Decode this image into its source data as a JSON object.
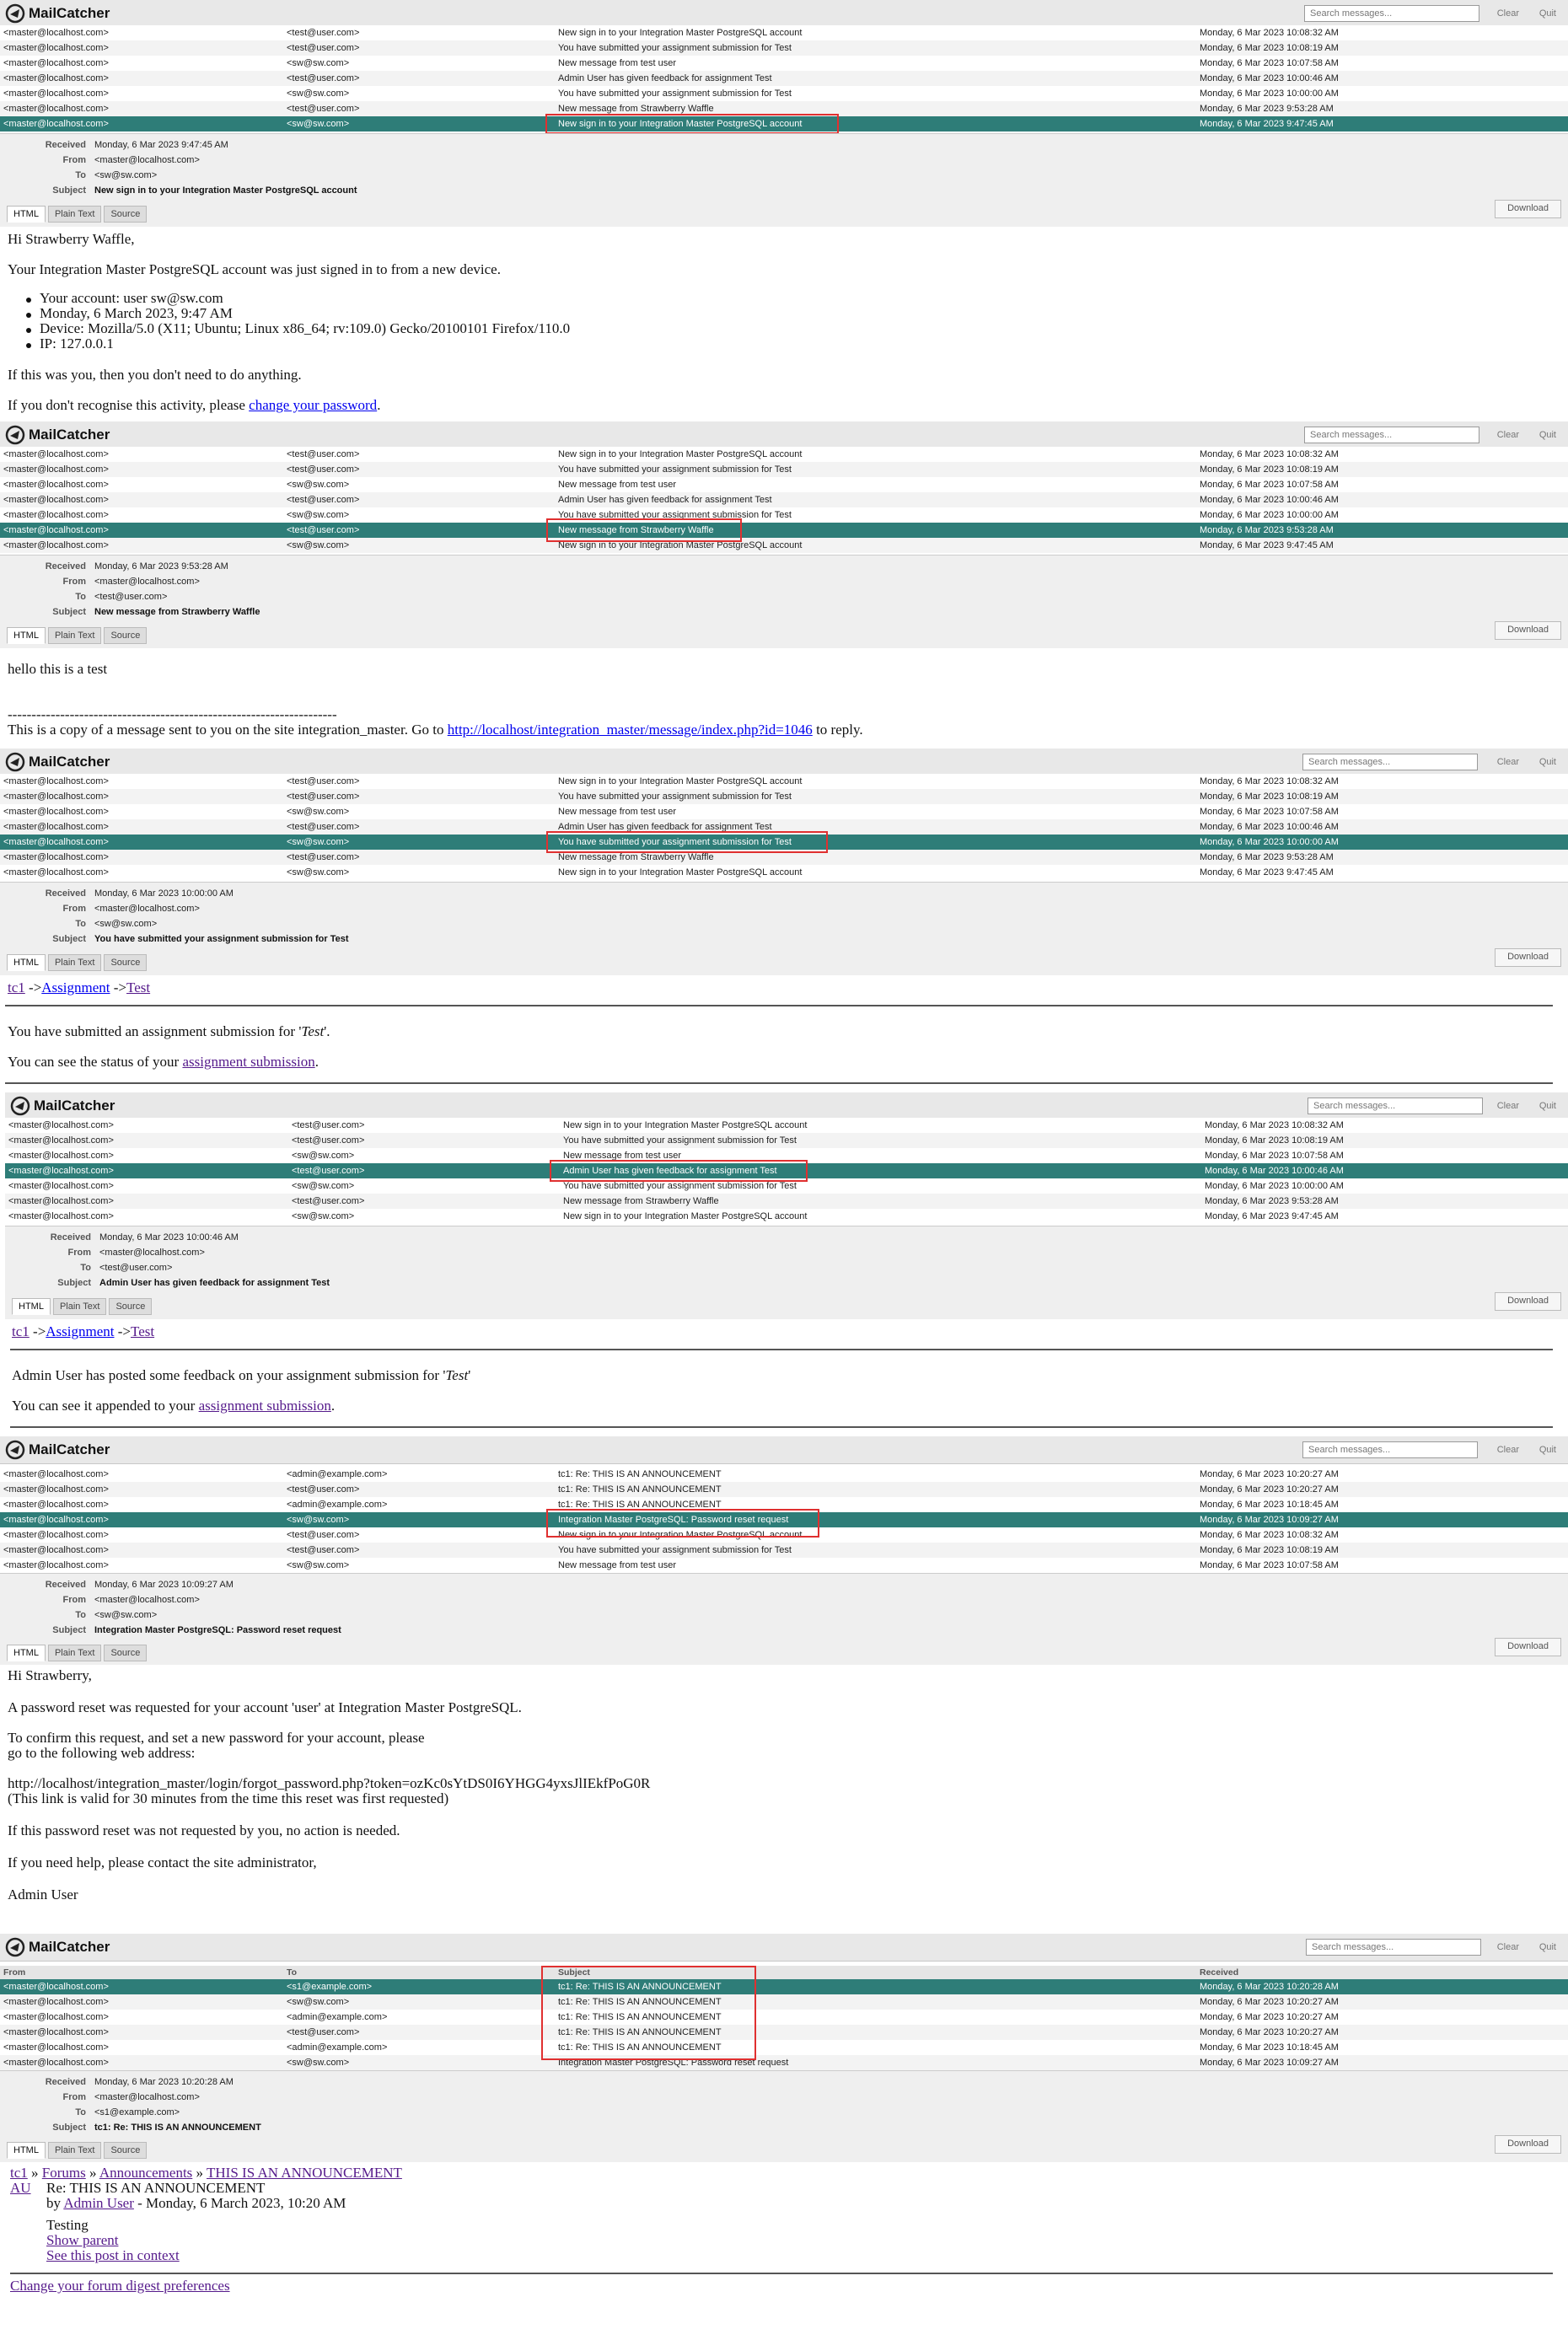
{
  "app": {
    "name": "MailCatcher",
    "search_placeholder": "Search messages...",
    "clear_label": "Clear",
    "quit_label": "Quit",
    "download_label": "Download"
  },
  "tabs": {
    "html": "HTML",
    "plain": "Plain Text",
    "source": "Source"
  },
  "meta_labels": {
    "received": "Received",
    "from": "From",
    "to": "To",
    "subject": "Subject"
  },
  "columns": {
    "from": "From",
    "to": "To",
    "subject": "Subject",
    "received": "Received"
  },
  "p1": {
    "rows": [
      {
        "from": "<master@localhost.com>",
        "to": "<test@user.com>",
        "subject": "New sign in to your Integration Master PostgreSQL account",
        "received": "Monday, 6 Mar 2023 10:08:32 AM"
      },
      {
        "from": "<master@localhost.com>",
        "to": "<test@user.com>",
        "subject": "You have submitted your assignment submission for Test",
        "received": "Monday, 6 Mar 2023 10:08:19 AM"
      },
      {
        "from": "<master@localhost.com>",
        "to": "<sw@sw.com>",
        "subject": "New message from test user",
        "received": "Monday, 6 Mar 2023 10:07:58 AM"
      },
      {
        "from": "<master@localhost.com>",
        "to": "<test@user.com>",
        "subject": "Admin User has given feedback for assignment Test",
        "received": "Monday, 6 Mar 2023 10:00:46 AM"
      },
      {
        "from": "<master@localhost.com>",
        "to": "<sw@sw.com>",
        "subject": "You have submitted your assignment submission for Test",
        "received": "Monday, 6 Mar 2023 10:00:00 AM"
      },
      {
        "from": "<master@localhost.com>",
        "to": "<test@user.com>",
        "subject": "New message from Strawberry Waffle",
        "received": "Monday, 6 Mar 2023 9:53:28 AM"
      },
      {
        "from": "<master@localhost.com>",
        "to": "<sw@sw.com>",
        "subject": "New sign in to your Integration Master PostgreSQL account",
        "received": "Monday, 6 Mar 2023 9:47:45 AM"
      }
    ],
    "meta": {
      "received": "Monday, 6 Mar 2023 9:47:45 AM",
      "from": "<master@localhost.com>",
      "to": "<sw@sw.com>",
      "subject": "New sign in to your Integration Master PostgreSQL account"
    },
    "greeting": "Hi Strawberry Waffle,",
    "intro": "Your Integration Master PostgreSQL account was just signed in to from a new device.",
    "bullets": [
      "Your account: user sw@sw.com",
      "Monday, 6 March 2023, 9:47 AM",
      "Device: Mozilla/5.0 (X11; Ubuntu; Linux x86_64; rv:109.0) Gecko/20100101 Firefox/110.0",
      "IP: 127.0.0.1"
    ],
    "if_you": "If this was you, then you don't need to do anything.",
    "dont_recognise": "If you don't recognise this activity, please",
    "change_link": "change your password",
    "period": "."
  },
  "p2": {
    "rows": [
      {
        "from": "<master@localhost.com>",
        "to": "<test@user.com>",
        "subject": "New sign in to your Integration Master PostgreSQL account",
        "received": "Monday, 6 Mar 2023 10:08:32 AM"
      },
      {
        "from": "<master@localhost.com>",
        "to": "<test@user.com>",
        "subject": "You have submitted your assignment submission for Test",
        "received": "Monday, 6 Mar 2023 10:08:19 AM"
      },
      {
        "from": "<master@localhost.com>",
        "to": "<sw@sw.com>",
        "subject": "New message from test user",
        "received": "Monday, 6 Mar 2023 10:07:58 AM"
      },
      {
        "from": "<master@localhost.com>",
        "to": "<test@user.com>",
        "subject": "Admin User has given feedback for assignment Test",
        "received": "Monday, 6 Mar 2023 10:00:46 AM"
      },
      {
        "from": "<master@localhost.com>",
        "to": "<sw@sw.com>",
        "subject": "You have submitted your assignment submission for Test",
        "received": "Monday, 6 Mar 2023 10:00:00 AM"
      },
      {
        "from": "<master@localhost.com>",
        "to": "<test@user.com>",
        "subject": "New message from Strawberry Waffle",
        "received": "Monday, 6 Mar 2023 9:53:28 AM"
      },
      {
        "from": "<master@localhost.com>",
        "to": "<sw@sw.com>",
        "subject": "New sign in to your Integration Master PostgreSQL account",
        "received": "Monday, 6 Mar 2023 9:47:45 AM"
      }
    ],
    "meta": {
      "received": "Monday, 6 Mar 2023 9:53:28 AM",
      "from": "<master@localhost.com>",
      "to": "<test@user.com>",
      "subject": "New message from Strawberry Waffle"
    },
    "line1": "hello this is a test",
    "dashes": "---------------------------------------------------------------------",
    "copy_text": "This is a copy of a message sent to you on the site integration_master. Go to",
    "copy_link": "http://localhost/integration_master/message/index.php?id=1046",
    "copy_end": "to reply."
  },
  "p3": {
    "rows": [
      {
        "from": "<master@localhost.com>",
        "to": "<test@user.com>",
        "subject": "New sign in to your Integration Master PostgreSQL account",
        "received": "Monday, 6 Mar 2023 10:08:32 AM"
      },
      {
        "from": "<master@localhost.com>",
        "to": "<test@user.com>",
        "subject": "You have submitted your assignment submission for Test",
        "received": "Monday, 6 Mar 2023 10:08:19 AM"
      },
      {
        "from": "<master@localhost.com>",
        "to": "<sw@sw.com>",
        "subject": "New message from test user",
        "received": "Monday, 6 Mar 2023 10:07:58 AM"
      },
      {
        "from": "<master@localhost.com>",
        "to": "<test@user.com>",
        "subject": "Admin User has given feedback for assignment Test",
        "received": "Monday, 6 Mar 2023 10:00:46 AM"
      },
      {
        "from": "<master@localhost.com>",
        "to": "<sw@sw.com>",
        "subject": "You have submitted your assignment submission for Test",
        "received": "Monday, 6 Mar 2023 10:00:00 AM"
      },
      {
        "from": "<master@localhost.com>",
        "to": "<test@user.com>",
        "subject": "New message from Strawberry Waffle",
        "received": "Monday, 6 Mar 2023 9:53:28 AM"
      },
      {
        "from": "<master@localhost.com>",
        "to": "<sw@sw.com>",
        "subject": "New sign in to your Integration Master PostgreSQL account",
        "received": "Monday, 6 Mar 2023 9:47:45 AM"
      }
    ],
    "meta": {
      "received": "Monday, 6 Mar 2023 10:00:00 AM",
      "from": "<master@localhost.com>",
      "to": "<sw@sw.com>",
      "subject": "You have submitted your assignment submission for Test"
    },
    "crumb": [
      "tc1",
      "Assignment",
      "Test"
    ],
    "arrow": "->",
    "line1_pre": "You have submitted an assignment submission for '",
    "line1_em": "Test",
    "line1_post": "'.",
    "line2_pre": "You can see the status of your",
    "line2_link": "assignment submission",
    "line2_post": "."
  },
  "p4": {
    "rows": [
      {
        "from": "<master@localhost.com>",
        "to": "<test@user.com>",
        "subject": "New sign in to your Integration Master PostgreSQL account",
        "received": "Monday, 6 Mar 2023 10:08:32 AM"
      },
      {
        "from": "<master@localhost.com>",
        "to": "<test@user.com>",
        "subject": "You have submitted your assignment submission for Test",
        "received": "Monday, 6 Mar 2023 10:08:19 AM"
      },
      {
        "from": "<master@localhost.com>",
        "to": "<sw@sw.com>",
        "subject": "New message from test user",
        "received": "Monday, 6 Mar 2023 10:07:58 AM"
      },
      {
        "from": "<master@localhost.com>",
        "to": "<test@user.com>",
        "subject": "Admin User has given feedback for assignment Test",
        "received": "Monday, 6 Mar 2023 10:00:46 AM"
      },
      {
        "from": "<master@localhost.com>",
        "to": "<sw@sw.com>",
        "subject": "You have submitted your assignment submission for Test",
        "received": "Monday, 6 Mar 2023 10:00:00 AM"
      },
      {
        "from": "<master@localhost.com>",
        "to": "<test@user.com>",
        "subject": "New message from Strawberry Waffle",
        "received": "Monday, 6 Mar 2023 9:53:28 AM"
      },
      {
        "from": "<master@localhost.com>",
        "to": "<sw@sw.com>",
        "subject": "New sign in to your Integration Master PostgreSQL account",
        "received": "Monday, 6 Mar 2023 9:47:45 AM"
      }
    ],
    "meta": {
      "received": "Monday, 6 Mar 2023 10:00:46 AM",
      "from": "<master@localhost.com>",
      "to": "<test@user.com>",
      "subject": "Admin User has given feedback for assignment Test"
    },
    "crumb": [
      "tc1",
      "Assignment",
      "Test"
    ],
    "arrow": "->",
    "line1_pre": "Admin User has posted some feedback on your assignment submission for '",
    "line1_em": "Test",
    "line1_post": "'",
    "line2_pre": "You can see it appended to your",
    "line2_link": "assignment submission",
    "line2_post": "."
  },
  "p5": {
    "rows": [
      {
        "from": "<master@localhost.com>",
        "to": "<admin@example.com>",
        "subject": "tc1: Re: THIS IS AN ANNOUNCEMENT",
        "received": "Monday, 6 Mar 2023 10:20:27 AM"
      },
      {
        "from": "<master@localhost.com>",
        "to": "<test@user.com>",
        "subject": "tc1: Re: THIS IS AN ANNOUNCEMENT",
        "received": "Monday, 6 Mar 2023 10:20:27 AM"
      },
      {
        "from": "<master@localhost.com>",
        "to": "<admin@example.com>",
        "subject": "tc1: Re: THIS IS AN ANNOUNCEMENT",
        "received": "Monday, 6 Mar 2023 10:18:45 AM"
      },
      {
        "from": "<master@localhost.com>",
        "to": "<sw@sw.com>",
        "subject": "Integration Master PostgreSQL: Password reset request",
        "received": "Monday, 6 Mar 2023 10:09:27 AM"
      },
      {
        "from": "<master@localhost.com>",
        "to": "<test@user.com>",
        "subject": "New sign in to your Integration Master PostgreSQL account",
        "received": "Monday, 6 Mar 2023 10:08:32 AM"
      },
      {
        "from": "<master@localhost.com>",
        "to": "<test@user.com>",
        "subject": "You have submitted your assignment submission for Test",
        "received": "Monday, 6 Mar 2023 10:08:19 AM"
      },
      {
        "from": "<master@localhost.com>",
        "to": "<sw@sw.com>",
        "subject": "New message from test user",
        "received": "Monday, 6 Mar 2023 10:07:58 AM"
      }
    ],
    "meta": {
      "received": "Monday, 6 Mar 2023 10:09:27 AM",
      "from": "<master@localhost.com>",
      "to": "<sw@sw.com>",
      "subject": "Integration Master PostgreSQL: Password reset request"
    },
    "l1": "Hi Strawberry,",
    "l2": "A password reset was requested for your account 'user' at Integration Master PostgreSQL.",
    "l3": "To confirm this request, and set a new password for your account, please",
    "l4": "go to the following web address:",
    "l5": "http://localhost/integration_master/login/forgot_password.php?token=ozKc0sYtDS0I6YHGG4yxsJlIEkfPoG0R",
    "l6": "(This link is valid for 30 minutes from the time this reset was first requested)",
    "l7": "If this password reset was not requested by you, no action is needed.",
    "l8": "If you need help, please contact the site administrator,",
    "l9": "Admin User"
  },
  "p6": {
    "rows": [
      {
        "from": "<master@localhost.com>",
        "to": "<s1@example.com>",
        "subject": "tc1: Re: THIS IS AN ANNOUNCEMENT",
        "received": "Monday, 6 Mar 2023 10:20:28 AM"
      },
      {
        "from": "<master@localhost.com>",
        "to": "<sw@sw.com>",
        "subject": "tc1: Re: THIS IS AN ANNOUNCEMENT",
        "received": "Monday, 6 Mar 2023 10:20:27 AM"
      },
      {
        "from": "<master@localhost.com>",
        "to": "<admin@example.com>",
        "subject": "tc1: Re: THIS IS AN ANNOUNCEMENT",
        "received": "Monday, 6 Mar 2023 10:20:27 AM"
      },
      {
        "from": "<master@localhost.com>",
        "to": "<test@user.com>",
        "subject": "tc1: Re: THIS IS AN ANNOUNCEMENT",
        "received": "Monday, 6 Mar 2023 10:20:27 AM"
      },
      {
        "from": "<master@localhost.com>",
        "to": "<admin@example.com>",
        "subject": "tc1: Re: THIS IS AN ANNOUNCEMENT",
        "received": "Monday, 6 Mar 2023 10:18:45 AM"
      },
      {
        "from": "<master@localhost.com>",
        "to": "<sw@sw.com>",
        "subject": "Integration Master PostgreSQL: Password reset request",
        "received": "Monday, 6 Mar 2023 10:09:27 AM"
      }
    ],
    "meta": {
      "received": "Monday, 6 Mar 2023 10:20:28 AM",
      "from": "<master@localhost.com>",
      "to": "<s1@example.com>",
      "subject": "tc1: Re: THIS IS AN ANNOUNCEMENT"
    },
    "crumb": [
      "tc1",
      "Forums",
      "Announcements",
      "THIS IS AN ANNOUNCEMENT"
    ],
    "sep": "»",
    "avatar": "AU",
    "post_title": "Re: THIS IS AN ANNOUNCEMENT",
    "by": "by",
    "author": "Admin User",
    "date": "- Monday, 6 March 2023, 10:20 AM",
    "message": "Testing",
    "show_parent": "Show parent",
    "see_context": "See this post in context",
    "digest": "Change your forum digest preferences"
  },
  "colors": {
    "selected_row": "#2e7d78",
    "link": "#0000ee",
    "visited_link": "#551a8b",
    "highlight_box": "#e03030"
  }
}
